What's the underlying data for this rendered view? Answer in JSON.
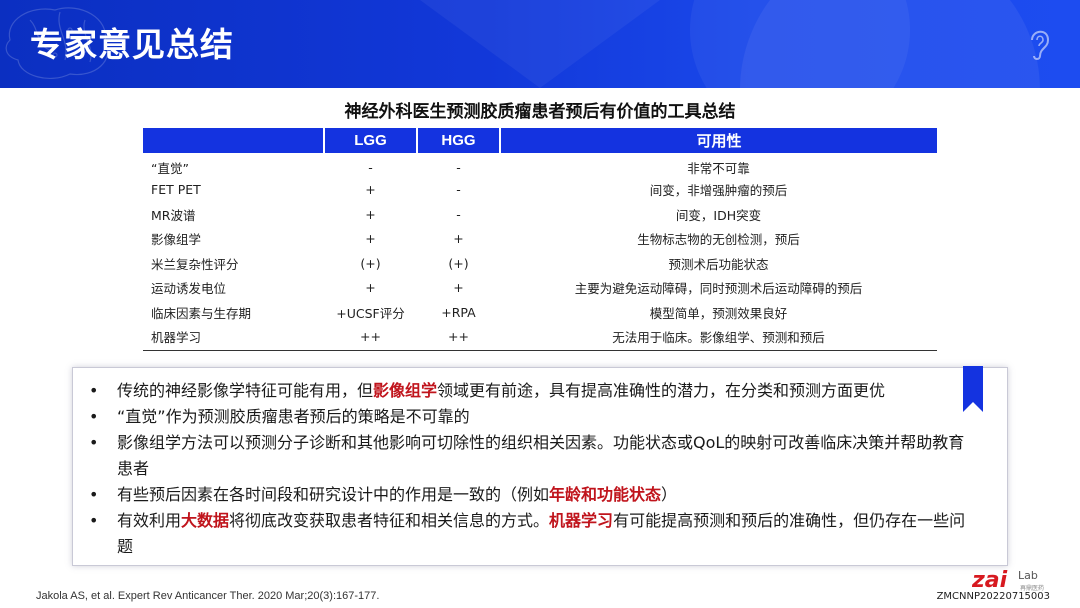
{
  "header": {
    "title": "专家意见总结"
  },
  "table": {
    "title": "神经外科医生预测胶质瘤患者预后有价值的工具总结",
    "columns": [
      "",
      "LGG",
      "HGG",
      "可用性"
    ],
    "rows": [
      [
        "“直觉”",
        "-",
        "-",
        "非常不可靠"
      ],
      [
        "FET PET",
        "+",
        "-",
        "间变，非增强肿瘤的预后"
      ],
      [
        "MR波谱",
        "+",
        "-",
        "间变，IDH突变"
      ],
      [
        "影像组学",
        "+",
        "+",
        "生物标志物的无创检测，预后"
      ],
      [
        "米兰复杂性评分",
        "(+)",
        "(+)",
        "预测术后功能状态"
      ],
      [
        "运动诱发电位",
        "+",
        "+",
        "主要为避免运动障碍，同时预测术后运动障碍的预后"
      ],
      [
        "临床因素与生存期",
        "+UCSF评分",
        "+RPA",
        "模型简单，预测效果良好"
      ],
      [
        "机器学习",
        "++",
        "++",
        "无法用于临床。影像组学、预测和预后"
      ]
    ]
  },
  "notes": {
    "bullet_symbol": "•",
    "items": [
      {
        "segments": [
          {
            "text": "传统的神经影像学特征可能有用，但",
            "hl": false
          },
          {
            "text": "影像组学",
            "hl": true
          },
          {
            "text": "领域更有前途，具有提高准确性的潜力，在分类和预测方面更优",
            "hl": false
          }
        ]
      },
      {
        "segments": [
          {
            "text": "“直觉”作为预测胶质瘤患者预后的策略是不可靠的",
            "hl": false
          }
        ]
      },
      {
        "segments": [
          {
            "text": "影像组学方法可以预测分子诊断和其他影响可切除性的组织相关因素。功能状态或QoL的映射可改善临床决策并帮助教育患者",
            "hl": false
          }
        ]
      },
      {
        "segments": [
          {
            "text": "有些预后因素在各时间段和研究设计中的作用是一致的（例如",
            "hl": false
          },
          {
            "text": "年龄和功能状态",
            "hl": true
          },
          {
            "text": "）",
            "hl": false
          }
        ]
      },
      {
        "segments": [
          {
            "text": "有效利用",
            "hl": false
          },
          {
            "text": "大数据",
            "hl": true
          },
          {
            "text": "将彻底改变获取患者特征和相关信息的方式。",
            "hl": false
          },
          {
            "text": "机器学习",
            "hl": true
          },
          {
            "text": "有可能提高预测和预后的准确性，但仍存在一些问题",
            "hl": false
          }
        ]
      }
    ]
  },
  "footer": {
    "citation": "Jakola AS, et al. Expert Rev Anticancer Ther. 2020 Mar;20(3):167-177.",
    "doc_code": "ZMCNNP20220715003",
    "logo_text": "zai",
    "logo_suffix": "Lab",
    "logo_subtext": "再鼎医药"
  },
  "colors": {
    "header_blue": "#1238d9",
    "table_header_blue": "#1433e0",
    "highlight_red": "#c0141c",
    "logo_red": "#d71920"
  },
  "icons": [
    "brain-icon",
    "ear-icon",
    "bookmark-icon",
    "zailab-logo"
  ]
}
